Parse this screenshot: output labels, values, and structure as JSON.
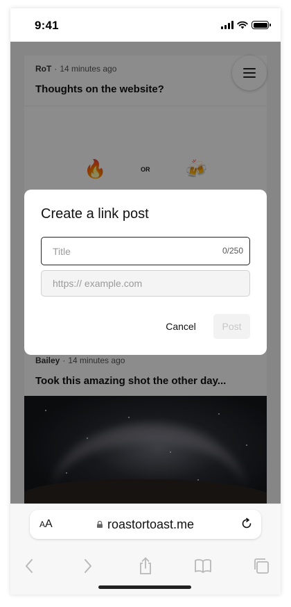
{
  "status": {
    "time": "9:41"
  },
  "feed": {
    "post1": {
      "author": "RoT",
      "time": "14 minutes ago",
      "title": "Thoughts on the website?",
      "poll_left": "🔥",
      "poll_or": "OR",
      "poll_right": "🍻"
    },
    "post2": {
      "author": "Bailey",
      "time": "14 minutes ago",
      "title": "Took this amazing shot the other day..."
    }
  },
  "modal": {
    "title": "Create a link post",
    "title_placeholder": "Title",
    "title_counter": "0/250",
    "url_placeholder": "https:// example.com",
    "cancel_label": "Cancel",
    "post_label": "Post"
  },
  "browser": {
    "aa_small": "A",
    "aa_large": "A",
    "url": "roastortoast.me"
  },
  "icons": {
    "menu": "hamburger-menu-icon",
    "lock": "lock-icon",
    "reload": "reload-icon",
    "back": "chevron-left-icon",
    "forward": "chevron-right-icon",
    "share": "share-icon",
    "bookmarks": "book-icon",
    "tabs": "tabs-icon"
  }
}
